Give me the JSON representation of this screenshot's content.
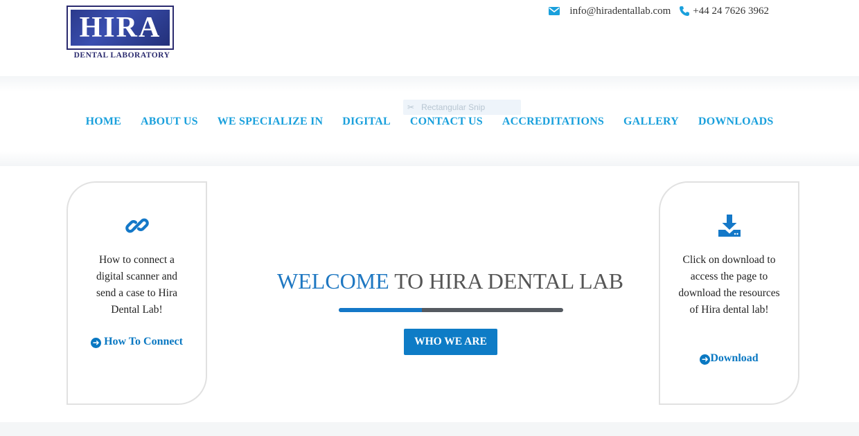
{
  "brand": {
    "logo_word": "HIRA",
    "logo_sub": "DENTAL LABORATORY",
    "accent_color": "#1aa0dc"
  },
  "contact": {
    "email": "info@hiradentallab.com",
    "phone": "+44 24 7626 3962",
    "email_icon": "envelope-icon",
    "phone_icon": "phone-icon"
  },
  "overlay": {
    "label": "Rectangular Snip",
    "icon": "scissors-icon"
  },
  "nav": {
    "items": [
      {
        "label": "HOME"
      },
      {
        "label": "ABOUT US"
      },
      {
        "label": "WE SPECIALIZE IN"
      },
      {
        "label": "DIGITAL"
      },
      {
        "label": "CONTACT US"
      },
      {
        "label": "ACCREDITATIONS"
      },
      {
        "label": "GALLERY"
      },
      {
        "label": "DOWNLOADS"
      }
    ]
  },
  "left_card": {
    "icon": "chain-link-icon",
    "text": "How to connect a digital scanner and send a case to Hira Dental Lab!",
    "link_label": "How To Connect",
    "link_icon": "arrow-circle-right-icon"
  },
  "right_card": {
    "icon": "download-icon",
    "text": "Click on download to access the page to download the resources of Hira dental lab!",
    "link_label": "Download",
    "link_icon": "arrow-circle-right-icon"
  },
  "hero": {
    "title_highlight": "WELCOME",
    "title_rest": "TO HIRA DENTAL LAB",
    "progress_fraction": 0.37,
    "button_label": "WHO WE ARE"
  }
}
